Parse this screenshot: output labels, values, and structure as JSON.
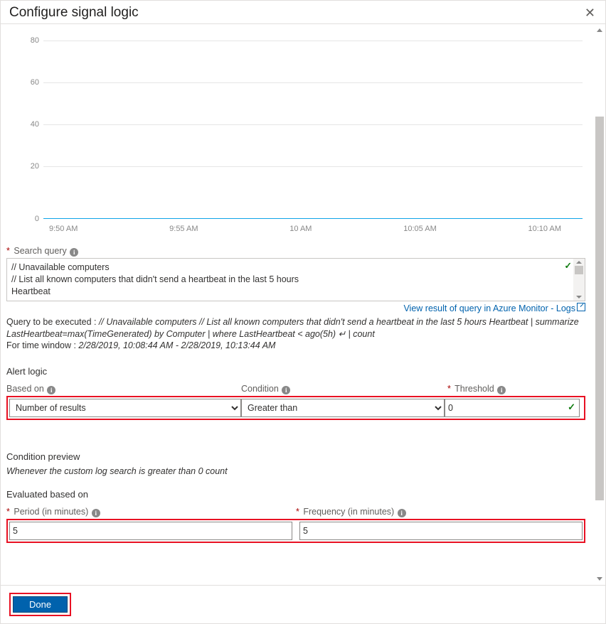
{
  "header": {
    "title": "Configure signal logic"
  },
  "chart_data": {
    "type": "line",
    "x": [
      "9:50 AM",
      "9:55 AM",
      "10 AM",
      "10:05 AM",
      "10:10 AM"
    ],
    "values": [
      0,
      0,
      0,
      0,
      0
    ],
    "y_ticks": [
      0,
      20,
      40,
      60,
      80
    ],
    "ylim": [
      0,
      80
    ]
  },
  "search_query": {
    "label": "Search query",
    "lines": [
      "// Unavailable computers",
      "// List all known computers that didn't send a heartbeat in the last 5 hours",
      "Heartbeat"
    ],
    "link": "View result of query in Azure Monitor - Logs"
  },
  "execution": {
    "prefix": "Query to be executed : ",
    "query": "// Unavailable computers // List all known computers that didn't send a heartbeat in the last 5 hours Heartbeat | summarize LastHeartbeat=max(TimeGenerated) by Computer | where LastHeartbeat < ago(5h) ↵ | count",
    "time_window_label": "For time window : ",
    "time_window_value": "2/28/2019, 10:08:44 AM - 2/28/2019, 10:13:44 AM"
  },
  "alert_logic": {
    "title": "Alert logic",
    "based_on_label": "Based on",
    "based_on_value": "Number of results",
    "condition_label": "Condition",
    "condition_value": "Greater than",
    "threshold_label": "Threshold",
    "threshold_value": "0"
  },
  "condition_preview": {
    "title": "Condition preview",
    "text": "Whenever the custom log search is greater than 0 count"
  },
  "evaluated": {
    "title": "Evaluated based on",
    "period_label": "Period (in minutes)",
    "period_value": "5",
    "frequency_label": "Frequency (in minutes)",
    "frequency_value": "5"
  },
  "footer": {
    "done_label": "Done"
  }
}
